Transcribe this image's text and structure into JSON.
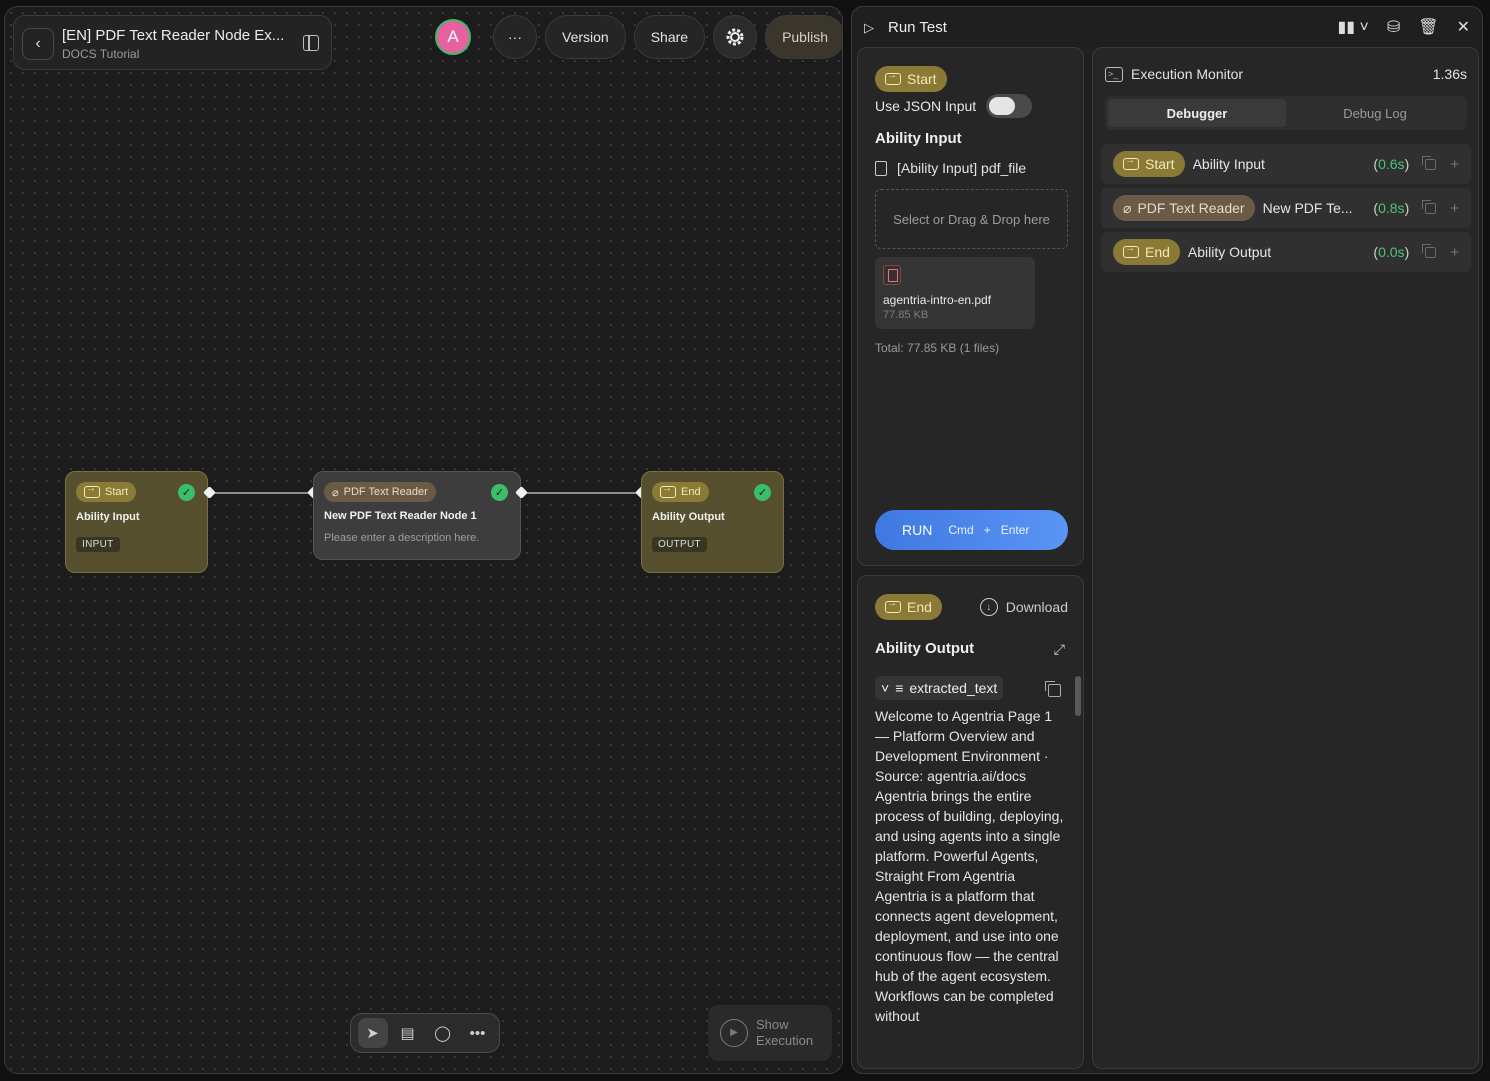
{
  "header": {
    "title": "[EN] PDF Text Reader Node Ex...",
    "subtitle": "DOCS Tutorial",
    "avatar_letter": "A",
    "more_label": "···",
    "version_label": "Version",
    "share_label": "Share",
    "publish_label": "Publish"
  },
  "nodes": {
    "start": {
      "badge": "Start",
      "title": "Ability Input",
      "tag": "INPUT"
    },
    "pdf": {
      "badge": "PDF Text Reader",
      "title": "New PDF Text Reader Node 1",
      "description": "Please enter a description here."
    },
    "end": {
      "badge": "End",
      "title": "Ability Output",
      "tag": "OUTPUT"
    }
  },
  "canvas": {
    "show_execution_line1": "Show",
    "show_execution_line2": "Execution"
  },
  "run_panel": {
    "title": "Run Test",
    "input": {
      "badge": "Start",
      "json_toggle_label": "Use JSON Input",
      "section_title": "Ability Input",
      "file_field_label": "[Ability Input] pdf_file",
      "dropzone_text": "Select or Drag & Drop here",
      "file_name": "agentria-intro-en.pdf",
      "file_size": "77.85 KB",
      "total": "Total: 77.85 KB (1 files)",
      "run_label": "RUN",
      "run_shortcut_cmd": "Cmd",
      "run_shortcut_plus": "+",
      "run_shortcut_enter": "Enter"
    },
    "output": {
      "badge": "End",
      "download_label": "Download",
      "section_title": "Ability Output",
      "field_name": "extracted_text",
      "text": "Welcome to Agentria Page 1 — Platform Overview and Development Environment · Source: agentria.ai/docs Agentria brings the entire process of building, deploying, and using agents into a single platform. Powerful Agents, Straight From Agentria Agentria is a platform that connects agent development, deployment, and use into one continuous flow — the central hub of the agent ecosystem. Workflows can be completed without"
    },
    "monitor": {
      "title": "Execution Monitor",
      "total_time": "1.36s",
      "tabs": [
        "Debugger",
        "Debug Log"
      ],
      "rows": [
        {
          "badge": "Start",
          "name": "Ability Input",
          "time_open": "(",
          "time": "0.6s",
          "time_close": ")"
        },
        {
          "badge": "PDF Text Reader",
          "name": "New PDF Te...",
          "time_open": "(",
          "time": "0.8s",
          "time_close": ")"
        },
        {
          "badge": "End",
          "name": "Ability Output",
          "time_open": "(",
          "time": "0.0s",
          "time_close": ")"
        }
      ]
    }
  }
}
